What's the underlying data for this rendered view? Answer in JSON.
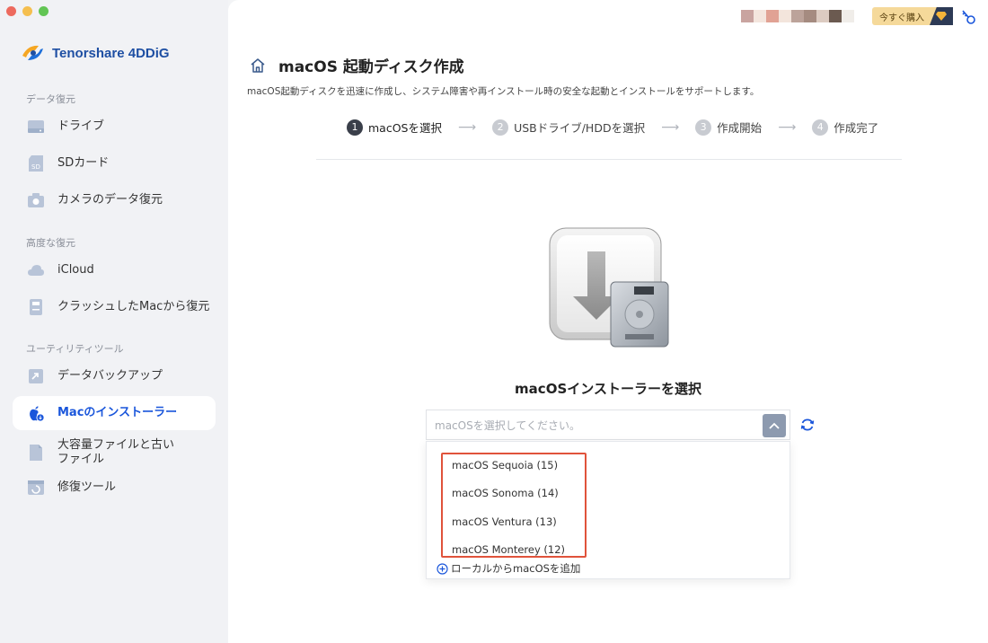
{
  "window": {
    "traffic_lights": [
      "#ed6a5e",
      "#f5bf4f",
      "#62c554"
    ]
  },
  "app": {
    "name": "Tenorshare 4DDiG",
    "brand_color": "#1e4fa3",
    "accent_color": "#1a56db"
  },
  "sidebar": {
    "sections": [
      {
        "label": "データ復元",
        "items": [
          {
            "label": "ドライブ",
            "icon": "drive-icon"
          },
          {
            "label": "SDカード",
            "icon": "sd-card-icon"
          },
          {
            "label": "カメラのデータ復元",
            "icon": "camera-icon"
          }
        ]
      },
      {
        "label": "高度な復元",
        "items": [
          {
            "label": "iCloud",
            "icon": "cloud-icon"
          },
          {
            "label": "クラッシュしたMacから復元",
            "icon": "crashed-mac-icon"
          }
        ]
      },
      {
        "label": "ユーティリティツール",
        "items": [
          {
            "label": "データバックアップ",
            "icon": "backup-icon"
          },
          {
            "label": "Macのインストーラー",
            "icon": "apple-installer-icon",
            "active": true
          },
          {
            "label": "大容量ファイルと古い\nファイル",
            "icon": "large-file-icon"
          },
          {
            "label": "修復ツール",
            "icon": "repair-icon"
          }
        ]
      }
    ]
  },
  "topbar": {
    "buy_label": "今すぐ購入",
    "swatches": [
      "#c9a4a0",
      "#f4e6de",
      "#e1a294",
      "#f3e5dc",
      "#bca39a",
      "#a58b80",
      "#dccbc1",
      "#6b5a50",
      "#f0ede9"
    ]
  },
  "header": {
    "title": "macOS 起動ディスク作成",
    "subtitle": "macOS起動ディスクを迅速に作成し、システム障害や再インストール時の安全な起動とインストールをサポートします。"
  },
  "steps": [
    {
      "num": "1",
      "label": "macOSを選択",
      "active": true
    },
    {
      "num": "2",
      "label": "USBドライブ/HDDを選択",
      "active": false
    },
    {
      "num": "3",
      "label": "作成開始",
      "active": false
    },
    {
      "num": "4",
      "label": "作成完了",
      "active": false
    }
  ],
  "selector": {
    "title": "macOSインストーラーを選択",
    "placeholder": "macOSを選択してください。",
    "options": [
      "macOS Sequoia (15)",
      "macOS Sonoma (14)",
      "macOS Ventura (13)",
      "macOS Monterey (12)"
    ],
    "add_local_label": "ローカルからmacOSを追加",
    "highlight_color": "#e0533b"
  }
}
